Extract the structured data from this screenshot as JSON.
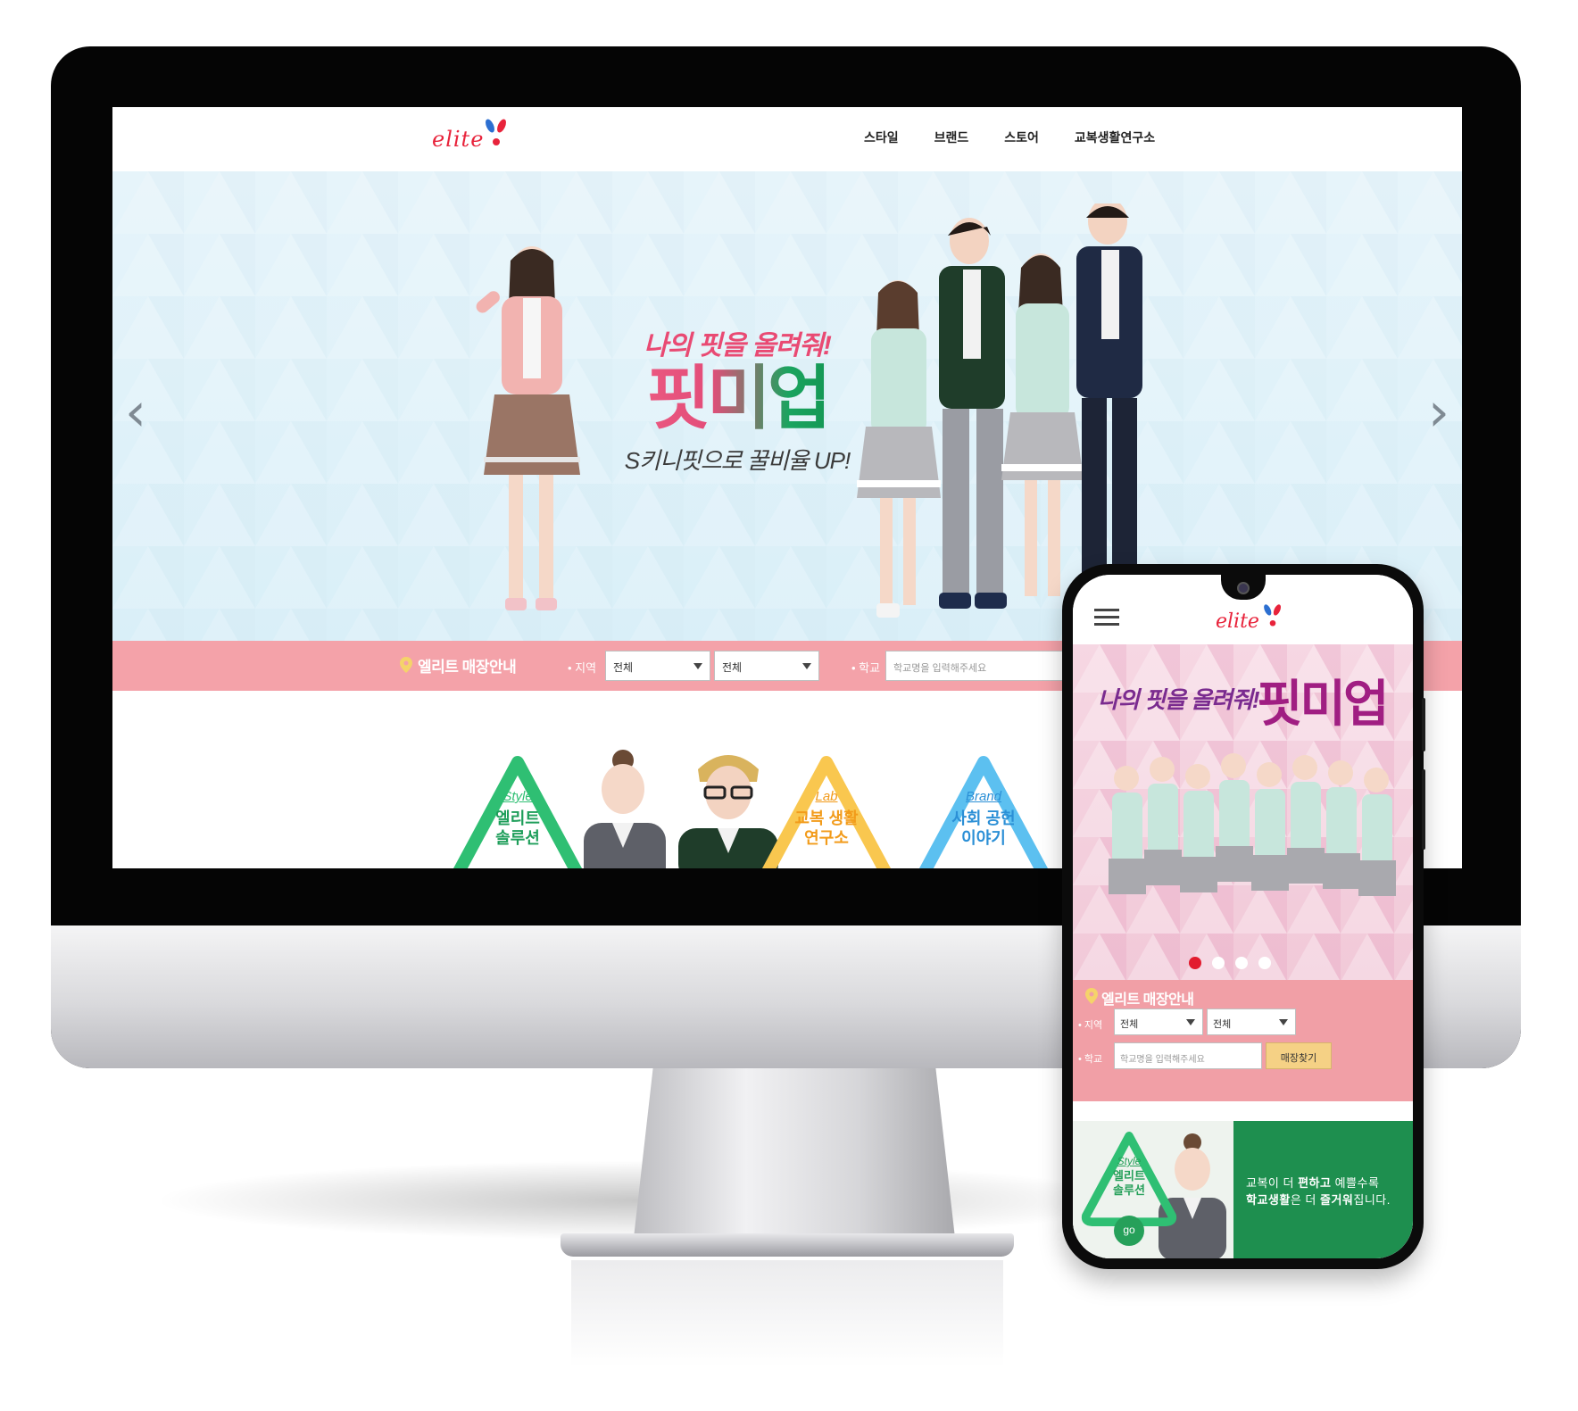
{
  "desktop": {
    "logo_text": "elite",
    "nav": [
      "스타일",
      "브랜드",
      "스토어",
      "교복생활연구소"
    ],
    "hero": {
      "line1": "나의 핏을 올려줘!",
      "title": "핏미업",
      "line3": "S키니핏으로 꿀비율 UP!",
      "prev_icon": "chevron-left-icon",
      "next_icon": "chevron-right-icon",
      "prev_glyph": "‹",
      "next_glyph": "›"
    },
    "store_search": {
      "title": "엘리트 매장안내",
      "region_label": "• 지역",
      "region_select_1": "전체",
      "region_select_2": "전체",
      "school_label": "• 학교",
      "school_placeholder": "학교명을 입력해주세요"
    },
    "cards": [
      {
        "category": "Style",
        "title_line1": "엘리트",
        "title_line2": "솔루션",
        "color": "#2fbf73"
      },
      {
        "category": "Lab",
        "title_line1": "교복 생활",
        "title_line2": "연구소",
        "color": "#f7ae2e"
      },
      {
        "category": "Brand",
        "title_line1": "사회 공헌",
        "title_line2": "이야기",
        "color": "#39a6e6"
      }
    ]
  },
  "mobile": {
    "logo_text": "elite",
    "menu_icon": "hamburger-menu-icon",
    "hero": {
      "line1": "나의 핏을 올려줘!",
      "title": "핏미업",
      "slide_count": 4,
      "active_slide": 1
    },
    "store_search": {
      "title": "엘리트 매장안내",
      "region_label": "• 지역",
      "region_select_1": "전체",
      "region_select_2": "전체",
      "school_label": "• 학교",
      "school_placeholder": "학교명을 입력해주세요",
      "find_button": "매장찾기"
    },
    "banner": {
      "category": "Style",
      "title_line1": "엘리트",
      "title_line2": "솔루션",
      "go_label": "go",
      "text_line1_a": "교복이 더 ",
      "text_line1_b": "편하고",
      "text_line1_c": " 예쁠수록",
      "text_line2_a": "학교생활",
      "text_line2_b": "은 더 ",
      "text_line2_c": "즐거워",
      "text_line2_d": "집니다."
    }
  },
  "colors": {
    "brand_red": "#e8233b",
    "search_bar_pink": "#f4a2a9",
    "style_green": "#2fbf73",
    "lab_yellow": "#f7ae2e",
    "brand_blue": "#39a6e6",
    "mobile_banner_green": "#1e8f4f"
  }
}
